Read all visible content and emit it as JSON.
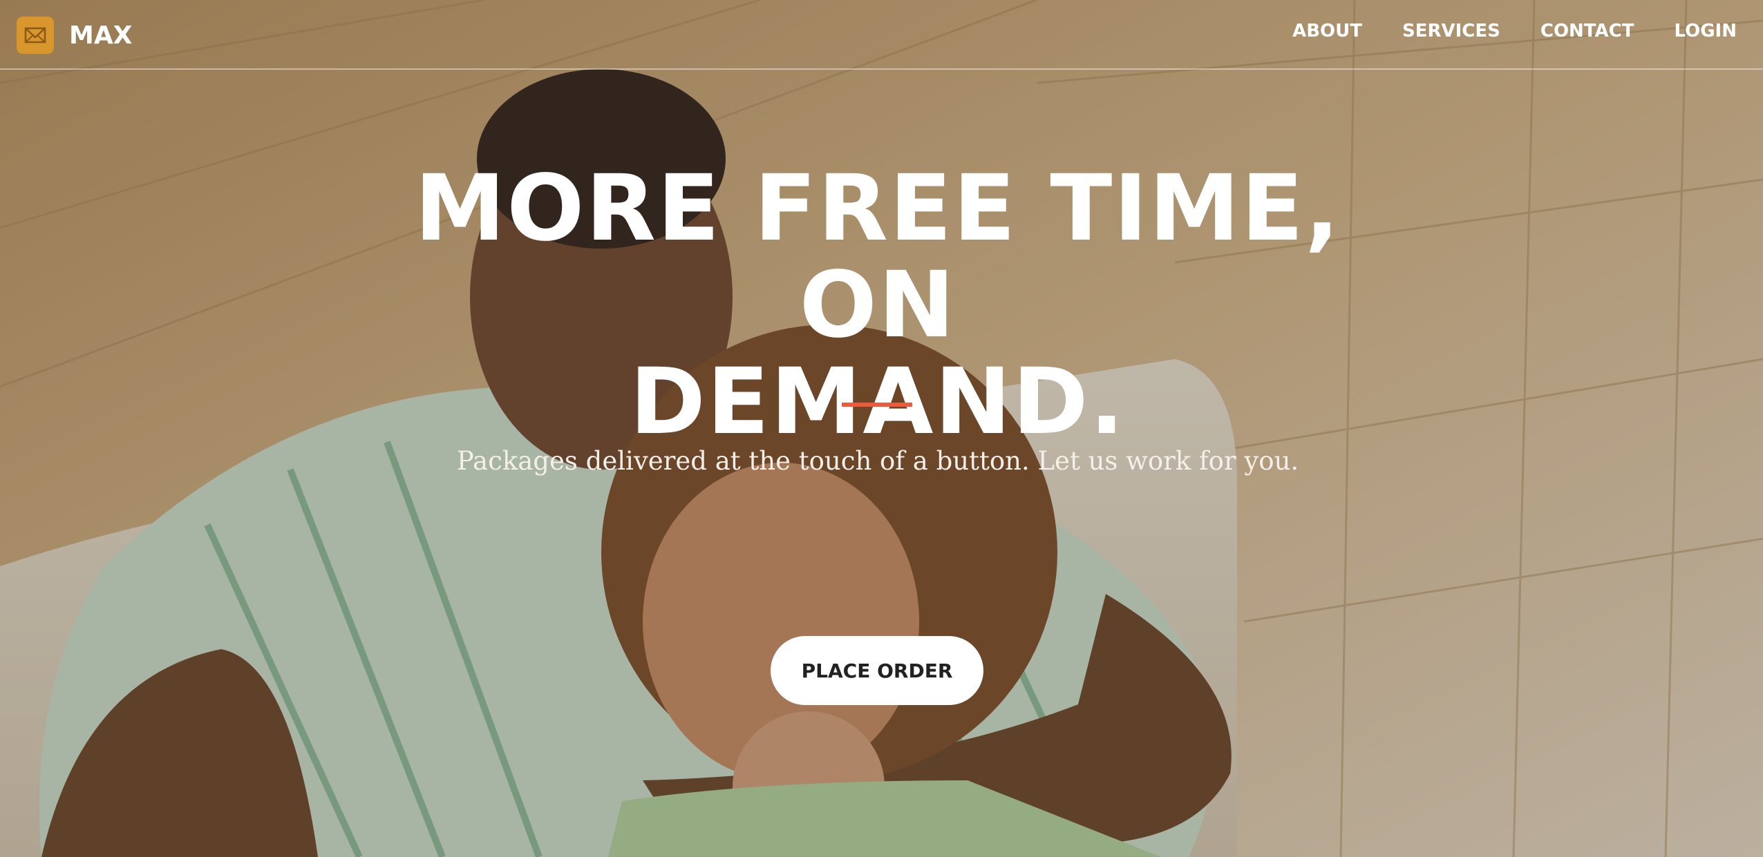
{
  "brand": {
    "name": "MAX",
    "logo_icon": "envelope-icon",
    "logo_color": "#d9962c"
  },
  "nav": {
    "items": [
      {
        "label": "ABOUT"
      },
      {
        "label": "SERVICES"
      },
      {
        "label": "CONTACT"
      },
      {
        "label": "LOGIN"
      }
    ]
  },
  "hero": {
    "headline_line1": "MORE FREE TIME, ON",
    "headline_line2": "DEMAND.",
    "subheadline": "Packages delivered at the touch of a button. Let us work for you.",
    "cta_label": "PLACE ORDER",
    "accent_color": "#ef5b3a",
    "background_image": "couple-hugging-on-couch-photo"
  }
}
